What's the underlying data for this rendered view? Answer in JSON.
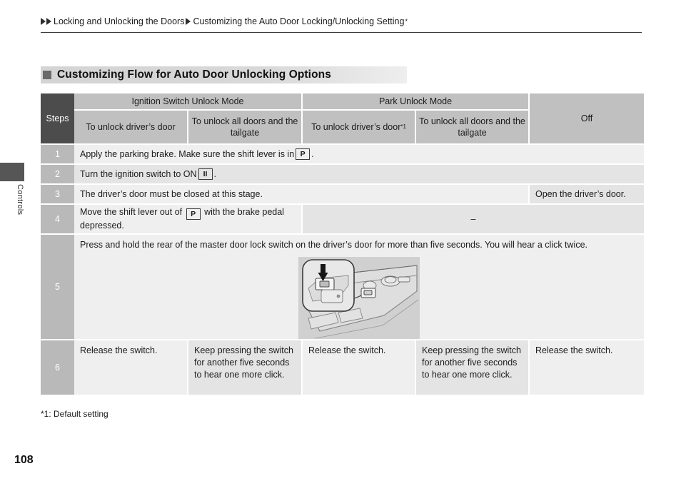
{
  "side_tab": {
    "label": "Controls"
  },
  "breadcrumb": {
    "item1": "Locking and Unlocking the Doors",
    "item2": "Customizing the Auto Door Locking/Unlocking Setting",
    "item2_sup": "*"
  },
  "heading": {
    "text": "Customizing Flow for Auto Door Unlocking Options"
  },
  "table": {
    "steps_header": "Steps",
    "group_headers": [
      {
        "label": "Ignition Switch Unlock Mode"
      },
      {
        "label": "Park Unlock Mode"
      },
      {
        "label": "Off"
      }
    ],
    "sub_headers": [
      {
        "label": "To unlock driver’s door",
        "sup": ""
      },
      {
        "label": "To unlock all doors and the tailgate",
        "sup": ""
      },
      {
        "label": "To unlock driver’s door",
        "sup": "*1"
      },
      {
        "label": "To unlock all doors and the tailgate",
        "sup": ""
      }
    ],
    "rows": [
      {
        "number": "1",
        "type": "span-all",
        "text_before": "Apply the parking brake. Make sure the shift lever is in ",
        "gear": "P",
        "text_after": "."
      },
      {
        "number": "2",
        "type": "span-all",
        "text_before": "Turn the ignition switch to ON ",
        "gear": "II",
        "text_after": "."
      },
      {
        "number": "3",
        "type": "split-4-1",
        "left_text": "The driver’s door must be closed at this stage.",
        "right_text": "Open the driver’s door."
      },
      {
        "number": "4",
        "type": "split-1-rest",
        "left_text_before": "Move the shift lever out of ",
        "gear": "P",
        "left_text_after": " with the brake pedal depressed.",
        "right_text": "–"
      },
      {
        "number": "5",
        "type": "illustration",
        "text": "Press and hold the rear of the master door lock switch on the driver’s door for more than five seconds. You will hear a click twice.",
        "illustration_name": "master-door-lock-switch-diagram"
      },
      {
        "number": "6",
        "type": "five-cells",
        "cells": [
          "Release the switch.",
          "Keep pressing the switch for another five seconds to hear one more click.",
          "Release the switch.",
          "Keep pressing the switch for another five seconds to hear one more click.",
          "Release the switch."
        ]
      }
    ]
  },
  "footnote": {
    "text": "*1: Default setting"
  },
  "page_number": {
    "text": "108"
  },
  "colors": {
    "steps_header_bg": "#4c4c4c",
    "step_number_bg": "#b9b9b9",
    "column_header_bg": "#c0c0c0",
    "cell_light": "#efefef",
    "cell_dark": "#e4e4e4",
    "heading_square": "#6a6a6a",
    "illustration_bg": "#d0d0d0"
  }
}
